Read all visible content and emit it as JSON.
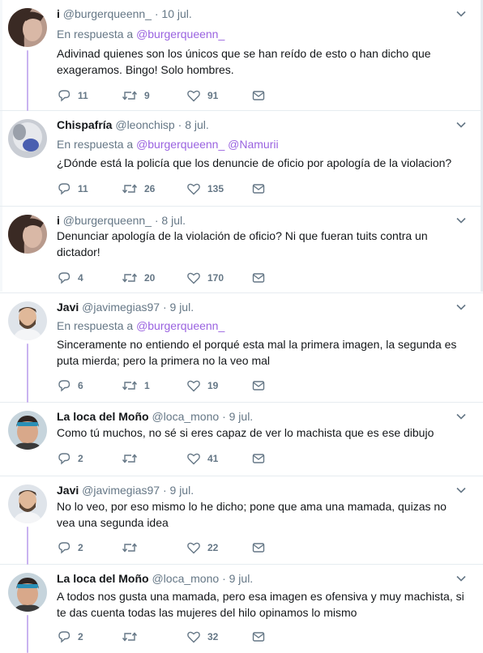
{
  "accent_color": "#9a63e0",
  "thread_color": "#c9b3f0",
  "tweets": [
    {
      "name": "i",
      "handle": "@burgerqueenn_",
      "date": "10 jul.",
      "reply_label": "En respuesta a",
      "reply_mentions": "@burgerqueenn_",
      "text": "Adivinad quienes son los únicos que se han reído de esto o han dicho que exageramos. Bingo! Solo hombres.",
      "replies": "11",
      "retweets": "9",
      "likes": "91",
      "avatar_icon": "avatar-dark-hair-icon"
    },
    {
      "name": "Chispafría",
      "handle": "@leonchisp",
      "date": "8 jul.",
      "reply_label": "En respuesta a",
      "reply_mentions": "@burgerqueenn_ @Namurii",
      "text": "¿Dónde está la policía que los denuncie de oficio por apología de la violacion?",
      "replies": "11",
      "retweets": "26",
      "likes": "135",
      "avatar_icon": "avatar-grey-blur-icon"
    },
    {
      "name": "i",
      "handle": "@burgerqueenn_",
      "date": "8 jul.",
      "reply_label": "",
      "reply_mentions": "",
      "text": "Denunciar apología de la violación de oficio? Ni que fueran tuits contra un dictador!",
      "replies": "4",
      "retweets": "20",
      "likes": "170",
      "avatar_icon": "avatar-dark-hair-icon"
    },
    {
      "name": "Javi",
      "handle": "@javimegias97",
      "date": "9 jul.",
      "reply_label": "En respuesta a",
      "reply_mentions": "@burgerqueenn_",
      "text": "Sinceramente no entiendo el porqué esta mal la primera imagen, la segunda es puta mierda; pero la primera no la veo mal",
      "replies": "6",
      "retweets": "1",
      "likes": "19",
      "avatar_icon": "avatar-bearded-man-icon"
    },
    {
      "name": "La loca del Moño",
      "handle": "@loca_mono",
      "date": "9 jul.",
      "reply_label": "",
      "reply_mentions": "",
      "text": "Como tú muchos, no sé si eres capaz de ver lo machista que es ese dibujo",
      "replies": "2",
      "retweets": "",
      "likes": "41",
      "avatar_icon": "avatar-woman-headband-icon"
    },
    {
      "name": "Javi",
      "handle": "@javimegias97",
      "date": "9 jul.",
      "reply_label": "",
      "reply_mentions": "",
      "text": "No lo veo, por eso mismo lo he dicho; pone que ama una mamada, quizas no vea una segunda idea",
      "replies": "2",
      "retweets": "",
      "likes": "22",
      "avatar_icon": "avatar-bearded-man-icon"
    },
    {
      "name": "La loca del Moño",
      "handle": "@loca_mono",
      "date": "9 jul.",
      "reply_label": "",
      "reply_mentions": "",
      "text": "A todos nos gusta una mamada, pero esa imagen es ofensiva y muy machista, si te das cuenta todas las mujeres del hilo opinamos lo mismo",
      "replies": "2",
      "retweets": "",
      "likes": "32",
      "avatar_icon": "avatar-woman-headband-icon"
    }
  ]
}
